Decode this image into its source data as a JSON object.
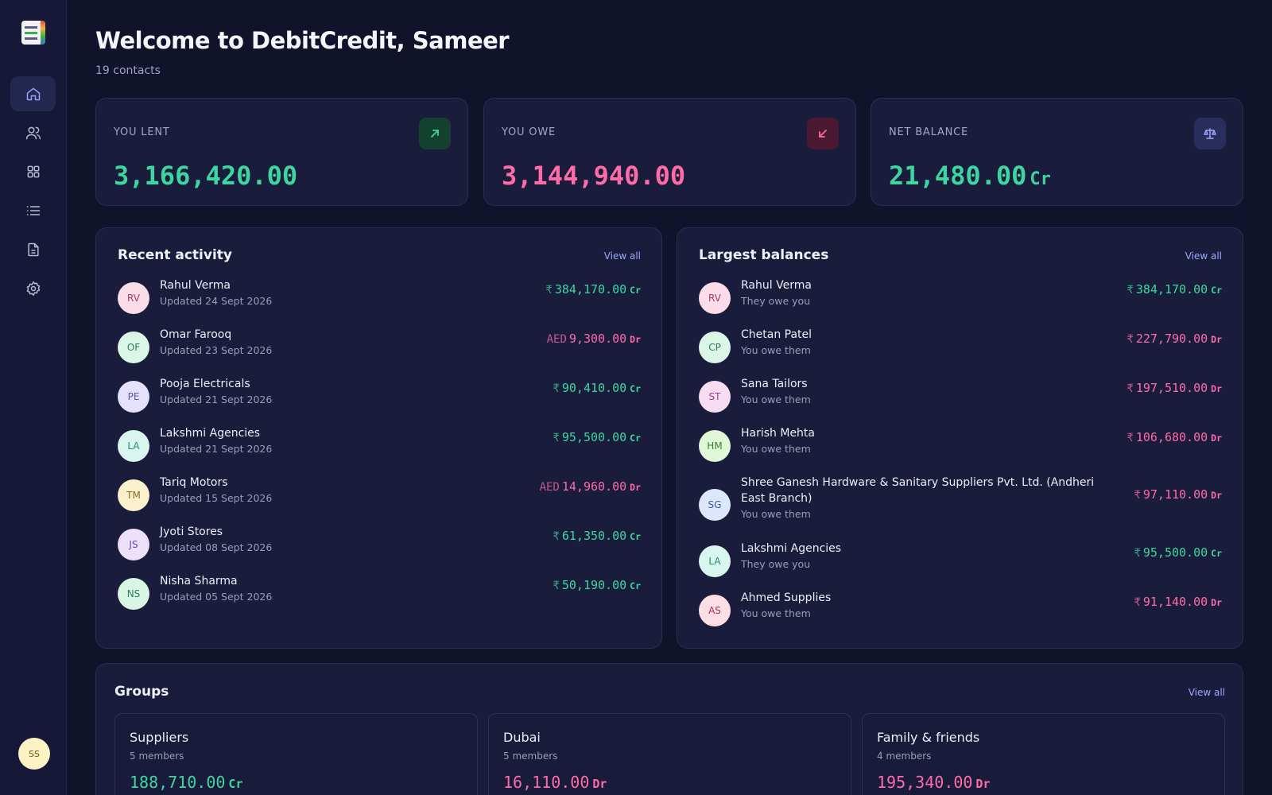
{
  "header": {
    "title": "Welcome to DebitCredit, Sameer",
    "subtitle": "19 contacts"
  },
  "sidebar": {
    "items": [
      {
        "name": "home",
        "icon": "home-icon",
        "active": true
      },
      {
        "name": "contacts",
        "icon": "users-icon",
        "active": false
      },
      {
        "name": "groups",
        "icon": "grid-icon",
        "active": false
      },
      {
        "name": "transactions",
        "icon": "list-icon",
        "active": false
      },
      {
        "name": "reports",
        "icon": "document-icon",
        "active": false
      },
      {
        "name": "settings",
        "icon": "gear-icon",
        "active": false
      }
    ],
    "user_initials": "SS"
  },
  "stats": [
    {
      "label": "YOU LENT",
      "value": "3,166,420.00",
      "suffix": "",
      "tone": "green",
      "icon": "arrow-up-right-icon"
    },
    {
      "label": "YOU OWE",
      "value": "3,144,940.00",
      "suffix": "",
      "tone": "pink",
      "icon": "arrow-down-left-icon"
    },
    {
      "label": "NET BALANCE",
      "value": "21,480.00",
      "suffix": "Cr",
      "tone": "green",
      "icon": "scale-icon"
    }
  ],
  "recent": {
    "title": "Recent activity",
    "view_all": "View all",
    "items": [
      {
        "initials": "RV",
        "name": "Rahul Verma",
        "sub": "Updated 24 Sept 2026",
        "currency": "₹",
        "amount": "384,170.00",
        "suffix": "Cr"
      },
      {
        "initials": "OF",
        "name": "Omar Farooq",
        "sub": "Updated 23 Sept 2026",
        "currency": "AED",
        "amount": "9,300.00",
        "suffix": "Dr"
      },
      {
        "initials": "PE",
        "name": "Pooja Electricals",
        "sub": "Updated 21 Sept 2026",
        "currency": "₹",
        "amount": "90,410.00",
        "suffix": "Cr"
      },
      {
        "initials": "LA",
        "name": "Lakshmi Agencies",
        "sub": "Updated 21 Sept 2026",
        "currency": "₹",
        "amount": "95,500.00",
        "suffix": "Cr"
      },
      {
        "initials": "TM",
        "name": "Tariq Motors",
        "sub": "Updated 15 Sept 2026",
        "currency": "AED",
        "amount": "14,960.00",
        "suffix": "Dr"
      },
      {
        "initials": "JS",
        "name": "Jyoti Stores",
        "sub": "Updated 08 Sept 2026",
        "currency": "₹",
        "amount": "61,350.00",
        "suffix": "Cr"
      },
      {
        "initials": "NS",
        "name": "Nisha Sharma",
        "sub": "Updated 05 Sept 2026",
        "currency": "₹",
        "amount": "50,190.00",
        "suffix": "Cr"
      }
    ]
  },
  "largest": {
    "title": "Largest balances",
    "view_all": "View all",
    "items": [
      {
        "initials": "RV",
        "name": "Rahul Verma",
        "sub": "They owe you",
        "currency": "₹",
        "amount": "384,170.00",
        "suffix": "Cr"
      },
      {
        "initials": "CP",
        "name": "Chetan Patel",
        "sub": "You owe them",
        "currency": "₹",
        "amount": "227,790.00",
        "suffix": "Dr"
      },
      {
        "initials": "ST",
        "name": "Sana Tailors",
        "sub": "You owe them",
        "currency": "₹",
        "amount": "197,510.00",
        "suffix": "Dr"
      },
      {
        "initials": "HM",
        "name": "Harish Mehta",
        "sub": "You owe them",
        "currency": "₹",
        "amount": "106,680.00",
        "suffix": "Dr"
      },
      {
        "initials": "SG",
        "name": "Shree Ganesh Hardware & Sanitary Suppliers Pvt. Ltd. (Andheri East Branch)",
        "sub": "You owe them",
        "currency": "₹",
        "amount": "97,110.00",
        "suffix": "Dr"
      },
      {
        "initials": "LA",
        "name": "Lakshmi Agencies",
        "sub": "They owe you",
        "currency": "₹",
        "amount": "95,500.00",
        "suffix": "Cr"
      },
      {
        "initials": "AS",
        "name": "Ahmed Supplies",
        "sub": "You owe them",
        "currency": "₹",
        "amount": "91,140.00",
        "suffix": "Dr"
      }
    ]
  },
  "groups": {
    "title": "Groups",
    "view_all": "View all",
    "items": [
      {
        "name": "Suppliers",
        "members": "5 members",
        "amount": "188,710.00",
        "suffix": "Cr"
      },
      {
        "name": "Dubai",
        "members": "5 members",
        "amount": "16,110.00",
        "suffix": "Dr"
      },
      {
        "name": "Family & friends",
        "members": "4 members",
        "amount": "195,340.00",
        "suffix": "Dr"
      }
    ]
  },
  "colors": {
    "credit": "#3ed6a0",
    "debit": "#ff6ba8",
    "accent": "#9ea7ff"
  }
}
